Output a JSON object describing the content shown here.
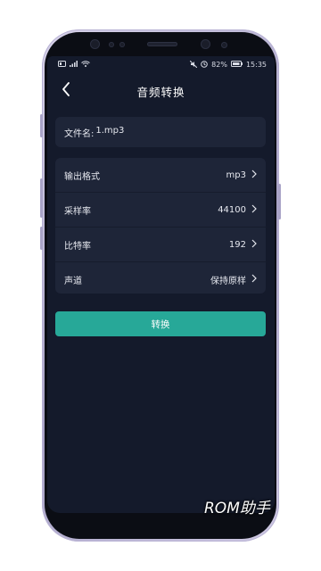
{
  "status_bar": {
    "battery": "82%",
    "time": "15:35",
    "left_icons": [
      "sim-icon",
      "signal-icon",
      "wifi-icon"
    ],
    "right_icons": [
      "mute-icon",
      "data-saver-icon",
      "battery-icon"
    ]
  },
  "header": {
    "title": "音频转换",
    "back_icon": "chevron-left-icon"
  },
  "file": {
    "label": "文件名:",
    "value": "1.mp3"
  },
  "settings": [
    {
      "label": "输出格式",
      "value": "mp3"
    },
    {
      "label": "采样率",
      "value": "44100"
    },
    {
      "label": "比特率",
      "value": "192"
    },
    {
      "label": "声道",
      "value": "保持原样"
    }
  ],
  "convert_button": {
    "label": "转换"
  },
  "watermark": "ROM助手",
  "colors": {
    "background": "#141a2b",
    "card": "#1e2538",
    "accent": "#27a898",
    "text": "#e6e8ef"
  }
}
